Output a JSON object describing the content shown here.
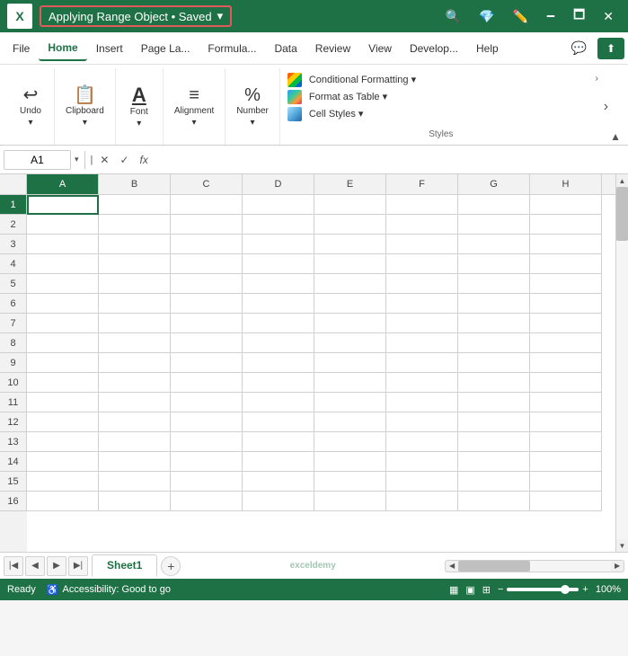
{
  "titlebar": {
    "logo": "X",
    "filename": "Applying Range Object • Saved",
    "dropdown_arrow": "▾",
    "icons": [
      "🔍",
      "💎",
      "✏️",
      "⬜",
      "✕"
    ],
    "search_tooltip": "Search",
    "share_tooltip": "Share",
    "minimize": "🗕",
    "maximize": "🗖",
    "close": "✕"
  },
  "menubar": {
    "items": [
      "File",
      "Home",
      "Insert",
      "Page La...",
      "Formula...",
      "Data",
      "Review",
      "View",
      "Develop...",
      "Help"
    ],
    "active_index": 1,
    "icons": {
      "comment": "💬",
      "share": "⬆"
    }
  },
  "ribbon": {
    "groups": [
      {
        "name": "Undo",
        "label": "Undo",
        "icon": "↩",
        "has_dropdown": true
      },
      {
        "name": "Clipboard",
        "label": "Clipboard",
        "icon": "📋",
        "has_dropdown": true
      },
      {
        "name": "Font",
        "label": "Font",
        "icon": "A",
        "has_dropdown": true
      },
      {
        "name": "Alignment",
        "label": "Alignment",
        "icon": "≡",
        "has_dropdown": true
      },
      {
        "name": "Number",
        "label": "Number",
        "icon": "%",
        "has_dropdown": true
      }
    ],
    "styles": {
      "label": "Styles",
      "conditional_formatting": "Conditional Formatting ▾",
      "format_as_table": "Format as Table ▾",
      "cell_styles": "Cell Styles ▾"
    },
    "expand_arrow": "›"
  },
  "formulabar": {
    "cell_ref": "A1",
    "dropdown_arrow": "▾",
    "cancel": "✕",
    "confirm": "✓",
    "fx": "fx",
    "formula_value": ""
  },
  "grid": {
    "columns": [
      "A",
      "B",
      "C",
      "D",
      "E",
      "F",
      "G",
      "H"
    ],
    "rows": [
      1,
      2,
      3,
      4,
      5,
      6,
      7,
      8,
      9,
      10,
      11,
      12,
      13,
      14,
      15,
      16
    ],
    "active_cell": "A1",
    "active_col": "A",
    "active_row": 1
  },
  "sheets": {
    "tabs": [
      "Sheet1"
    ],
    "active": "Sheet1",
    "add_label": "+"
  },
  "statusbar": {
    "status": "Ready",
    "accessibility": "Accessibility: Good to go",
    "view_normal": "▦",
    "view_layout": "▣",
    "view_page": "⊞",
    "zoom_minus": "−",
    "zoom_plus": "+",
    "zoom_level": "100%"
  }
}
